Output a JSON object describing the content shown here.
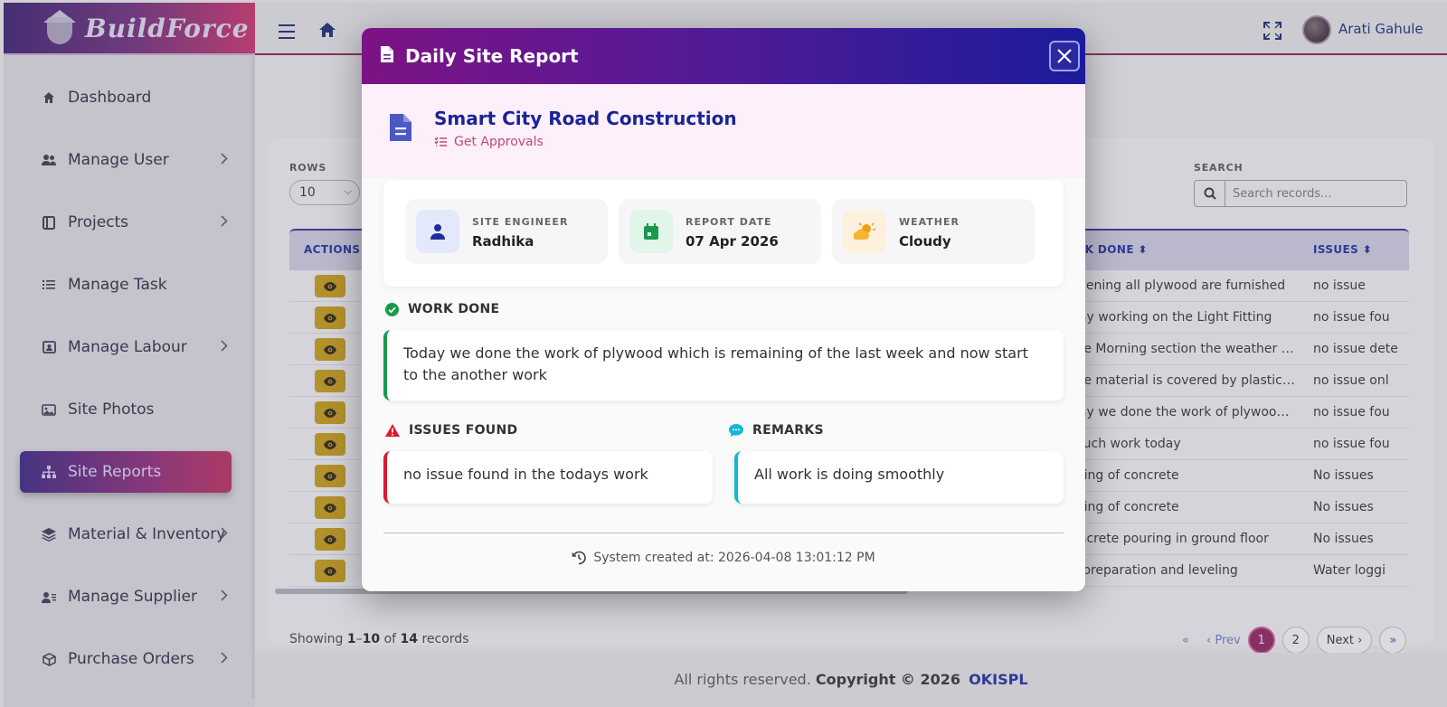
{
  "app": {
    "logo_text": "BuildForce"
  },
  "sidebar": {
    "items": [
      {
        "label": "Dashboard",
        "icon": "home-icon",
        "has_submenu": false
      },
      {
        "label": "Manage User",
        "icon": "users-icon",
        "has_submenu": true
      },
      {
        "label": "Projects",
        "icon": "book-icon",
        "has_submenu": true
      },
      {
        "label": "Manage Task",
        "icon": "list-icon",
        "has_submenu": false
      },
      {
        "label": "Manage Labour",
        "icon": "id-card-icon",
        "has_submenu": true
      },
      {
        "label": "Site Photos",
        "icon": "image-icon",
        "has_submenu": false
      },
      {
        "label": "Site Reports",
        "icon": "sitemap-icon",
        "has_submenu": false,
        "active": true
      },
      {
        "label": "Material & Inventory",
        "icon": "layers-icon",
        "has_submenu": true
      },
      {
        "label": "Manage Supplier",
        "icon": "user-list-icon",
        "has_submenu": true
      },
      {
        "label": "Purchase Orders",
        "icon": "box-icon",
        "has_submenu": true
      }
    ]
  },
  "header": {
    "user_name": "Arati Gahule"
  },
  "table": {
    "rows_label": "ROWS",
    "rows_value": "10",
    "search_label": "SEARCH",
    "search_placeholder": "Search records...",
    "columns": {
      "actions": "ACTIONS",
      "work_done": "RK DONE",
      "issues": "ISSUES"
    },
    "rows": [
      {
        "work": " evening all plywood are furnished",
        "issue": "no issue"
      },
      {
        "work": "day working on the Light Fitting",
        "issue": "no issue fou"
      },
      {
        "work": "the Morning section the weather is...",
        "issue": "no issue dete"
      },
      {
        "work": " the material is covered by plastic ...",
        "issue": "no issue onl"
      },
      {
        "work": "day we done the work of plywood ...",
        "issue": "no issue fou"
      },
      {
        "work": " much work today",
        "issue": "no issue fou"
      },
      {
        "work": "uring of concrete",
        "issue": "No issues"
      },
      {
        "work": "uring of concrete",
        "issue": "No issues"
      },
      {
        "work": "oncrete pouring in ground floor",
        "issue": "No issues"
      },
      {
        "work": "e preparation and leveling",
        "issue": "Water loggi"
      }
    ],
    "showing_prefix": "Showing",
    "showing_from": "1",
    "showing_dash": "–",
    "showing_to": "10",
    "showing_of": "of",
    "showing_total": "14",
    "showing_suffix": "records",
    "pager": {
      "prev": "Prev",
      "pages": [
        "1",
        "2"
      ],
      "current": "1",
      "next": "Next"
    }
  },
  "footer": {
    "text": "All rights reserved.",
    "copyright": "Copyright © 2026",
    "brand": "OKISPL"
  },
  "modal": {
    "title": "Daily Site Report",
    "project_name": "Smart City Road Construction",
    "get_approvals": "Get Approvals",
    "info": [
      {
        "label": "SITE ENGINEER",
        "value": "Radhika",
        "icon": "user-icon",
        "color": "#1d2d9a",
        "bg": "#e3e8fb"
      },
      {
        "label": "REPORT DATE",
        "value": "07 Apr 2026",
        "icon": "calendar-icon",
        "color": "#17994c",
        "bg": "#e1f5e8"
      },
      {
        "label": "WEATHER",
        "value": "Cloudy",
        "icon": "cloud-sun-icon",
        "color": "#e8a319",
        "bg": "#fdf1de"
      }
    ],
    "work_done_title": "WORK DONE",
    "work_done_text": "Today we done the work of plywood which is remaining of the last week and now start to the another work",
    "issues_title": "ISSUES FOUND",
    "issues_text": "no issue found in the todays work",
    "remarks_title": "REMARKS",
    "remarks_text": "All work is doing smoothly",
    "system_created": "System created at: 2026-04-08 13:01:12 PM"
  },
  "colors": {
    "accent_blue": "#1b2596",
    "accent_green": "#17994c",
    "accent_red": "#d81b2e",
    "accent_cyan": "#14b8d4",
    "eye_button": "#c09616",
    "pager_current": "#8b1f5e"
  }
}
